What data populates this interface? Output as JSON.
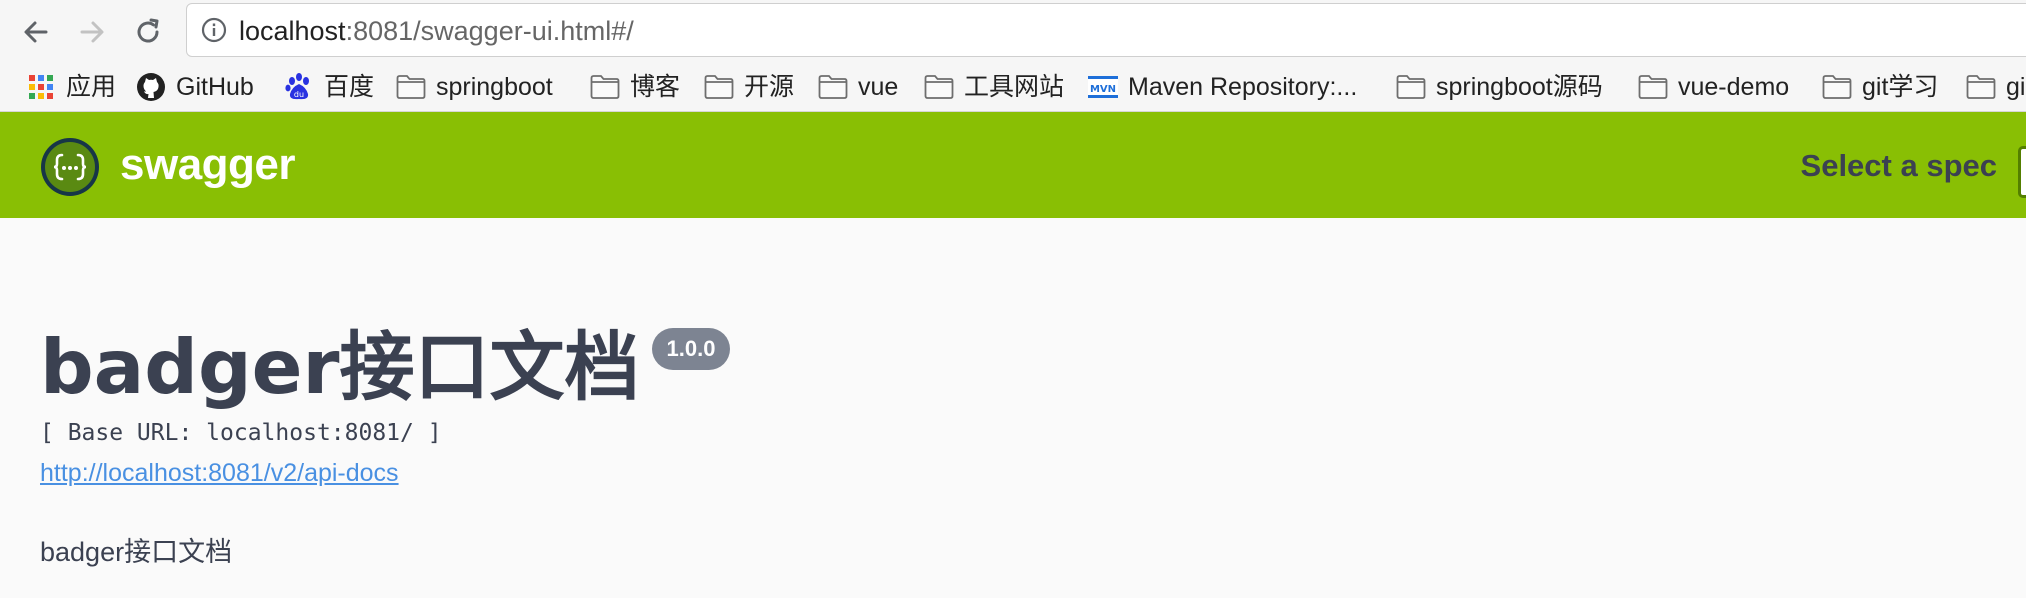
{
  "browser": {
    "url_host": "localhost",
    "url_rest": ":8081/swagger-ui.html#/"
  },
  "bookmarks": [
    {
      "label": "应用",
      "icon": "apps-grid-icon"
    },
    {
      "label": "GitHub",
      "icon": "github-icon"
    },
    {
      "label": "百度",
      "icon": "baidu-paw-icon"
    },
    {
      "label": "springboot",
      "icon": "folder-icon"
    },
    {
      "label": "博客",
      "icon": "folder-icon"
    },
    {
      "label": "开源",
      "icon": "folder-icon"
    },
    {
      "label": "vue",
      "icon": "folder-icon"
    },
    {
      "label": "工具网站",
      "icon": "folder-icon"
    },
    {
      "label": "Maven Repository:...",
      "icon": "mvn-icon"
    },
    {
      "label": "springboot源码",
      "icon": "folder-icon"
    },
    {
      "label": "vue-demo",
      "icon": "folder-icon"
    },
    {
      "label": "git学习",
      "icon": "folder-icon"
    },
    {
      "label": "gi",
      "icon": "folder-icon"
    }
  ],
  "swagger": {
    "logo_text": "swagger",
    "select_spec_label": "Select a spec",
    "brand_color": "#89bf04"
  },
  "info": {
    "title": "badger接口文档",
    "version": "1.0.0",
    "base_url": "[ Base URL: localhost:8081/ ]",
    "docs_link": "http://localhost:8081/v2/api-docs",
    "description": "badger接口文档"
  }
}
